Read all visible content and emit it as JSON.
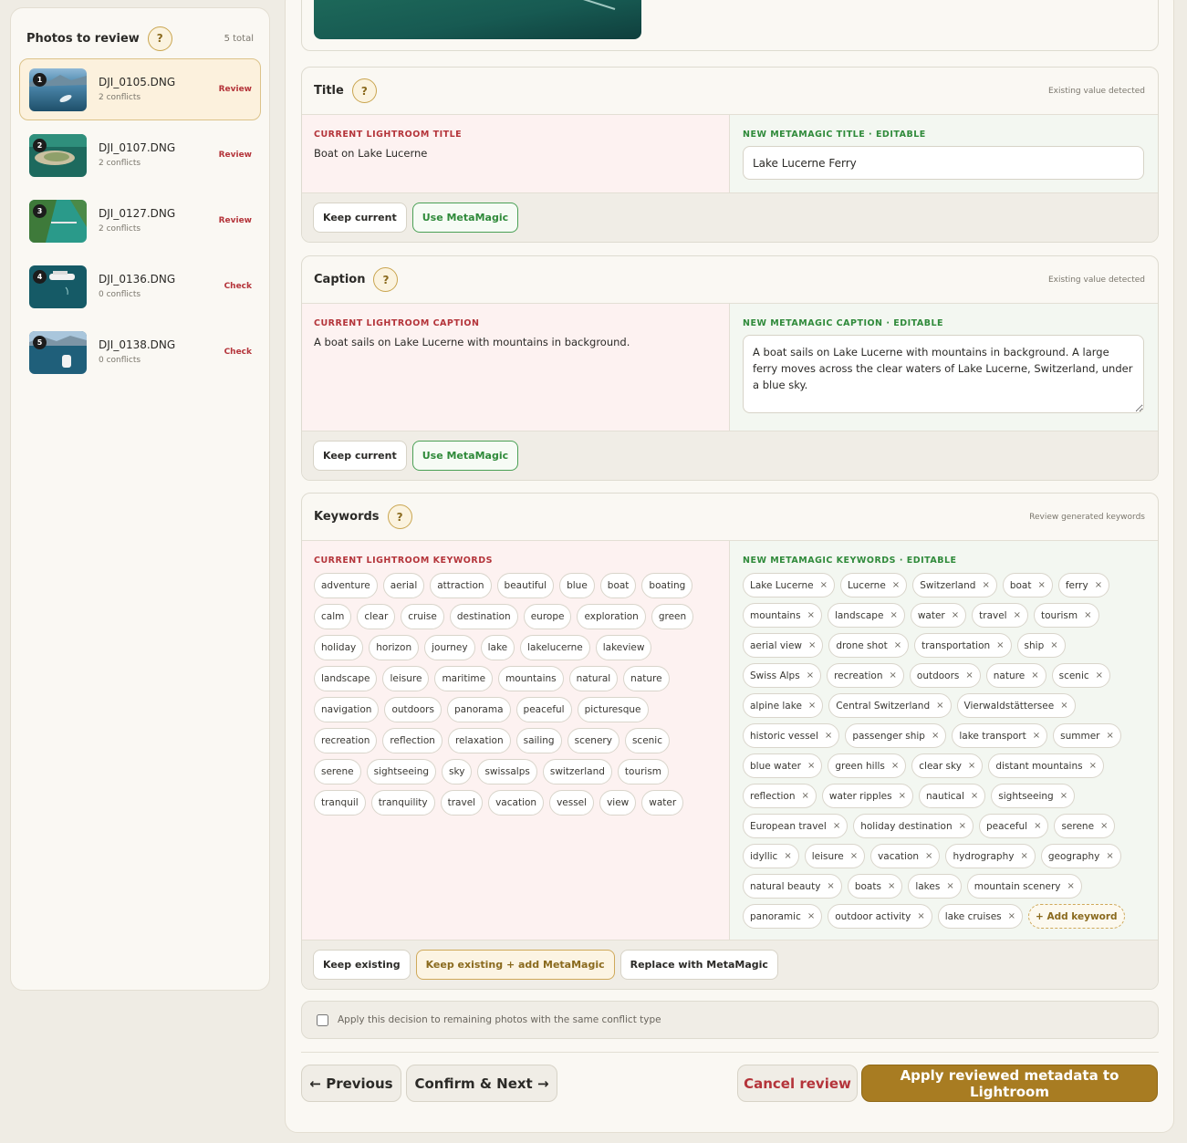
{
  "sidebar": {
    "title": "Photos to review",
    "help": "?",
    "total": "5 total",
    "photos": [
      {
        "num": "1",
        "name": "DJI_0105.DNG",
        "conflicts": "2 conflicts",
        "status": "Review"
      },
      {
        "num": "2",
        "name": "DJI_0107.DNG",
        "conflicts": "2 conflicts",
        "status": "Review"
      },
      {
        "num": "3",
        "name": "DJI_0127.DNG",
        "conflicts": "2 conflicts",
        "status": "Review"
      },
      {
        "num": "4",
        "name": "DJI_0136.DNG",
        "conflicts": "0 conflicts",
        "status": "Check"
      },
      {
        "num": "5",
        "name": "DJI_0138.DNG",
        "conflicts": "0 conflicts",
        "status": "Check"
      }
    ]
  },
  "title_card": {
    "title": "Title",
    "help": "?",
    "note": "Existing value detected",
    "current_label": "CURRENT LIGHTROOM TITLE",
    "current_value": "Boat on Lake Lucerne",
    "new_label": "NEW METAMAGIC TITLE · EDITABLE",
    "new_value": "Lake Lucerne Ferry",
    "keep": "Keep current",
    "use": "Use MetaMagic"
  },
  "caption_card": {
    "title": "Caption",
    "help": "?",
    "note": "Existing value detected",
    "current_label": "CURRENT LIGHTROOM CAPTION",
    "current_value": "A boat sails on Lake Lucerne with mountains in background.",
    "new_label": "NEW METAMAGIC CAPTION · EDITABLE",
    "new_value": "A boat sails on Lake Lucerne with mountains in background. A large ferry moves across the clear waters of Lake Lucerne, Switzerland, under a blue sky.",
    "keep": "Keep current",
    "use": "Use MetaMagic"
  },
  "keywords_card": {
    "title": "Keywords",
    "help": "?",
    "note": "Review generated keywords",
    "current_label": "CURRENT LIGHTROOM KEYWORDS",
    "new_label": "NEW METAMAGIC KEYWORDS · EDITABLE",
    "current": [
      "adventure",
      "aerial",
      "attraction",
      "beautiful",
      "blue",
      "boat",
      "boating",
      "calm",
      "clear",
      "cruise",
      "destination",
      "europe",
      "exploration",
      "green",
      "holiday",
      "horizon",
      "journey",
      "lake",
      "lakelucerne",
      "lakeview",
      "landscape",
      "leisure",
      "maritime",
      "mountains",
      "natural",
      "nature",
      "navigation",
      "outdoors",
      "panorama",
      "peaceful",
      "picturesque",
      "recreation",
      "reflection",
      "relaxation",
      "sailing",
      "scenery",
      "scenic",
      "serene",
      "sightseeing",
      "sky",
      "swissalps",
      "switzerland",
      "tourism",
      "tranquil",
      "tranquility",
      "travel",
      "vacation",
      "vessel",
      "view",
      "water"
    ],
    "new": [
      "Lake Lucerne",
      "Lucerne",
      "Switzerland",
      "boat",
      "ferry",
      "mountains",
      "landscape",
      "water",
      "travel",
      "tourism",
      "aerial view",
      "drone shot",
      "transportation",
      "ship",
      "Swiss Alps",
      "recreation",
      "outdoors",
      "nature",
      "scenic",
      "alpine lake",
      "Central Switzerland",
      "Vierwaldstättersee",
      "historic vessel",
      "passenger ship",
      "lake transport",
      "summer",
      "blue water",
      "green hills",
      "clear sky",
      "distant mountains",
      "reflection",
      "water ripples",
      "nautical",
      "sightseeing",
      "European travel",
      "holiday destination",
      "peaceful",
      "serene",
      "idyllic",
      "leisure",
      "vacation",
      "hydrography",
      "geography",
      "natural beauty",
      "boats",
      "lakes",
      "mountain scenery",
      "panoramic",
      "outdoor activity",
      "lake cruises"
    ],
    "remove_glyph": "×",
    "add_keyword": "+ Add keyword",
    "keep_existing": "Keep existing",
    "keep_add": "Keep existing + add MetaMagic",
    "replace": "Replace with MetaMagic"
  },
  "apply_all": "Apply this decision to remaining photos with the same conflict type",
  "nav": {
    "previous": "← Previous",
    "confirm_next": "Confirm & Next →",
    "cancel": "Cancel review",
    "apply": "Apply reviewed metadata to Lightroom"
  }
}
